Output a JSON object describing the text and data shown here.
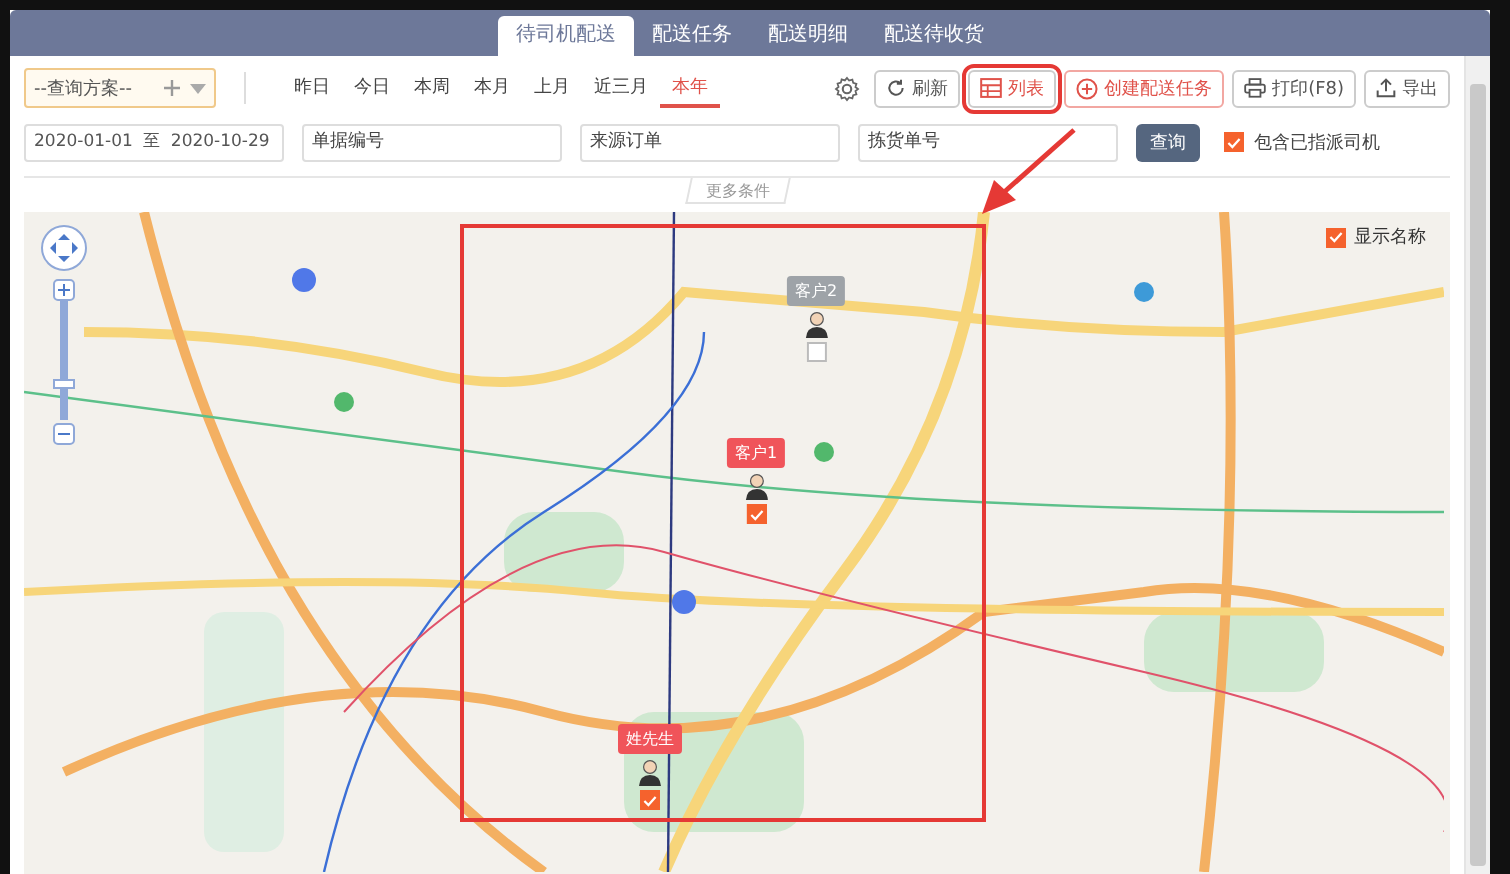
{
  "header_tabs": [
    {
      "label": "待司机配送",
      "selected": true
    },
    {
      "label": "配送任务",
      "selected": false
    },
    {
      "label": "配送明细",
      "selected": false
    },
    {
      "label": "配送待收货",
      "selected": false
    }
  ],
  "query_scheme": {
    "placeholder": "--查询方案--"
  },
  "date_shortcuts": [
    {
      "label": "昨日",
      "selected": false
    },
    {
      "label": "今日",
      "selected": false
    },
    {
      "label": "本周",
      "selected": false
    },
    {
      "label": "本月",
      "selected": false
    },
    {
      "label": "上月",
      "selected": false
    },
    {
      "label": "近三月",
      "selected": false
    },
    {
      "label": "本年",
      "selected": true
    }
  ],
  "toolbar_buttons": [
    {
      "kind": "settings"
    },
    {
      "kind": "refresh",
      "label": "刷新"
    },
    {
      "kind": "list",
      "label": "列表"
    },
    {
      "kind": "create",
      "label": "创建配送任务"
    },
    {
      "kind": "print",
      "label": "打印(F8)"
    },
    {
      "kind": "export",
      "label": "导出"
    }
  ],
  "filters": {
    "date_range": {
      "start": "2020-01-01",
      "separator": "至",
      "end": "2020-10-29"
    },
    "fields": [
      {
        "placeholder": "单据编号"
      },
      {
        "placeholder": "来源订单"
      },
      {
        "placeholder": "拣货单号"
      }
    ],
    "search_button": "查询",
    "include_assigned": {
      "label": "包含已指派司机",
      "checked": true
    },
    "more_conditions": "更多条件"
  },
  "map": {
    "show_names": {
      "label": "显示名称",
      "checked": true
    },
    "markers": [
      {
        "name": "客户2",
        "checked": false
      },
      {
        "name": "客户1",
        "checked": true
      },
      {
        "name": "姓先生",
        "checked": true
      }
    ]
  }
}
